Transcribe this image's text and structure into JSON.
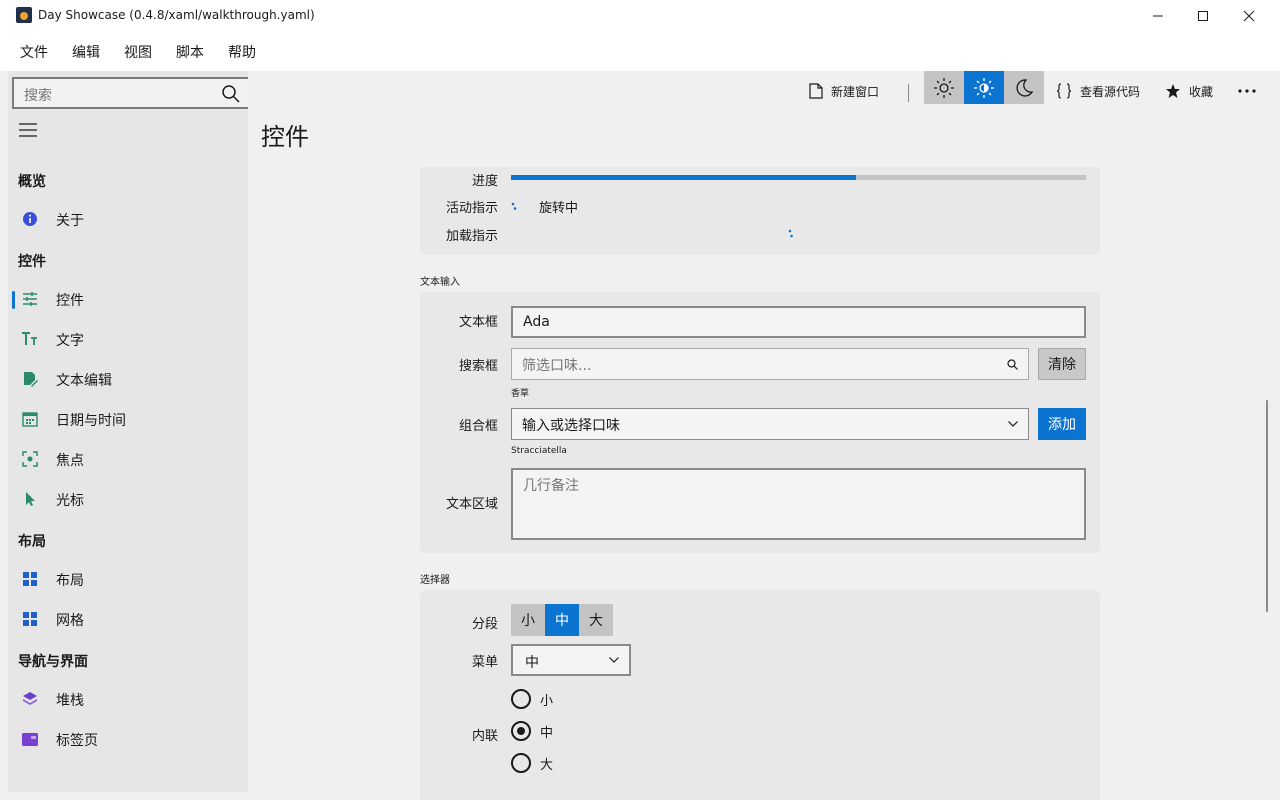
{
  "window": {
    "title": "Day Showcase (0.4.8/xaml/walkthrough.yaml)"
  },
  "menu": [
    "文件",
    "编辑",
    "视图",
    "脚本",
    "帮助"
  ],
  "search": {
    "placeholder": "搜索"
  },
  "sidebar": {
    "sections": [
      {
        "title": "概览",
        "items": [
          {
            "label": "关于",
            "icon": "info-icon"
          }
        ]
      },
      {
        "title": "控件",
        "items": [
          {
            "label": "控件",
            "icon": "sliders-icon",
            "active": true
          },
          {
            "label": "文字",
            "icon": "text-icon"
          },
          {
            "label": "文本编辑",
            "icon": "edit-document-icon"
          },
          {
            "label": "日期与时间",
            "icon": "calendar-icon"
          },
          {
            "label": "焦点",
            "icon": "focus-icon"
          },
          {
            "label": "光标",
            "icon": "cursor-icon"
          }
        ]
      },
      {
        "title": "布局",
        "items": [
          {
            "label": "布局",
            "icon": "layout-grid-icon"
          },
          {
            "label": "网格",
            "icon": "grid-icon"
          }
        ]
      },
      {
        "title": "导航与界面",
        "items": [
          {
            "label": "堆栈",
            "icon": "stack-icon"
          },
          {
            "label": "标签页",
            "icon": "tabs-icon"
          }
        ]
      }
    ]
  },
  "toolbar": {
    "new_window": "新建窗口",
    "view_source": "查看源代码",
    "favorite": "收藏",
    "theme_selected": "auto"
  },
  "page": {
    "title": "控件"
  },
  "status": {
    "progress_label": "进度",
    "progress_value": 0.6,
    "activity_label": "活动指示",
    "activity_text": "旋转中",
    "loading_label": "加载指示"
  },
  "text_input": {
    "group_title": "文本输入",
    "textbox_label": "文本框",
    "textbox_value": "Ada",
    "searchbox_label": "搜索框",
    "searchbox_placeholder": "筛选口味...",
    "clear_button": "清除",
    "searchbox_helper": "香草",
    "combobox_label": "组合框",
    "combobox_value": "输入或选择口味",
    "add_button": "添加",
    "combobox_helper": "Stracciatella",
    "textarea_label": "文本区域",
    "textarea_placeholder": "几行备注"
  },
  "selectors": {
    "group_title": "选择器",
    "segment_label": "分段",
    "segments": [
      "小",
      "中",
      "大"
    ],
    "segment_selected": "中",
    "menu_label": "菜单",
    "menu_value": "中",
    "inline_label": "内联",
    "radios": [
      "小",
      "中",
      "大"
    ],
    "radio_selected": "中"
  },
  "colors": {
    "accent": "#0a74d0"
  }
}
